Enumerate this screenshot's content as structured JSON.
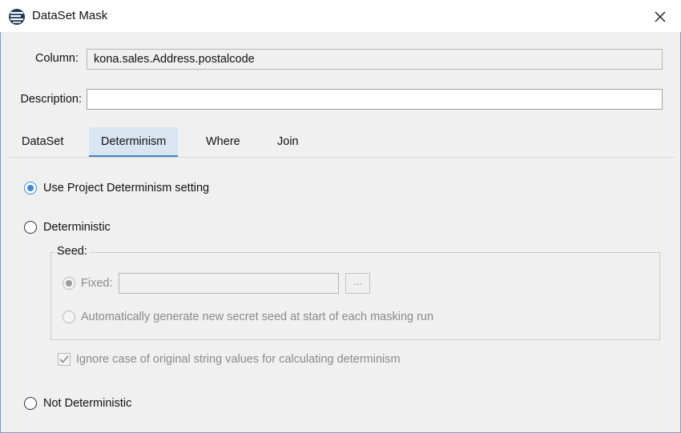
{
  "window": {
    "title": "DataSet Mask",
    "app_icon": "stacked-lines-icon",
    "close_icon": "close-icon"
  },
  "form": {
    "column_label": "Column:",
    "column_value": "kona.sales.Address.postalcode",
    "description_label": "Description:",
    "description_value": ""
  },
  "tabs": [
    {
      "label": "DataSet",
      "active": false
    },
    {
      "label": "Determinism",
      "active": true
    },
    {
      "label": "Where",
      "active": false
    },
    {
      "label": "Join",
      "active": false
    }
  ],
  "determinism": {
    "use_project": {
      "label": "Use Project Determinism setting",
      "checked": true
    },
    "deterministic": {
      "label": "Deterministic",
      "checked": false
    },
    "seed": {
      "legend": "Seed:",
      "fixed": {
        "label": "Fixed:",
        "checked": true,
        "enabled": false,
        "value": ""
      },
      "browse_label": "...",
      "auto": {
        "label": "Automatically generate new secret seed at start of each masking run",
        "checked": false,
        "enabled": false
      }
    },
    "ignore_case": {
      "label": "Ignore case of original string values for calculating determinism",
      "checked": true,
      "enabled": false
    },
    "not_deterministic": {
      "label": "Not Deterministic",
      "checked": false
    }
  },
  "colors": {
    "accent": "#3b8ad6",
    "active_tab_bg": "#d9e5f1",
    "disabled_text": "#8a8a8a"
  }
}
